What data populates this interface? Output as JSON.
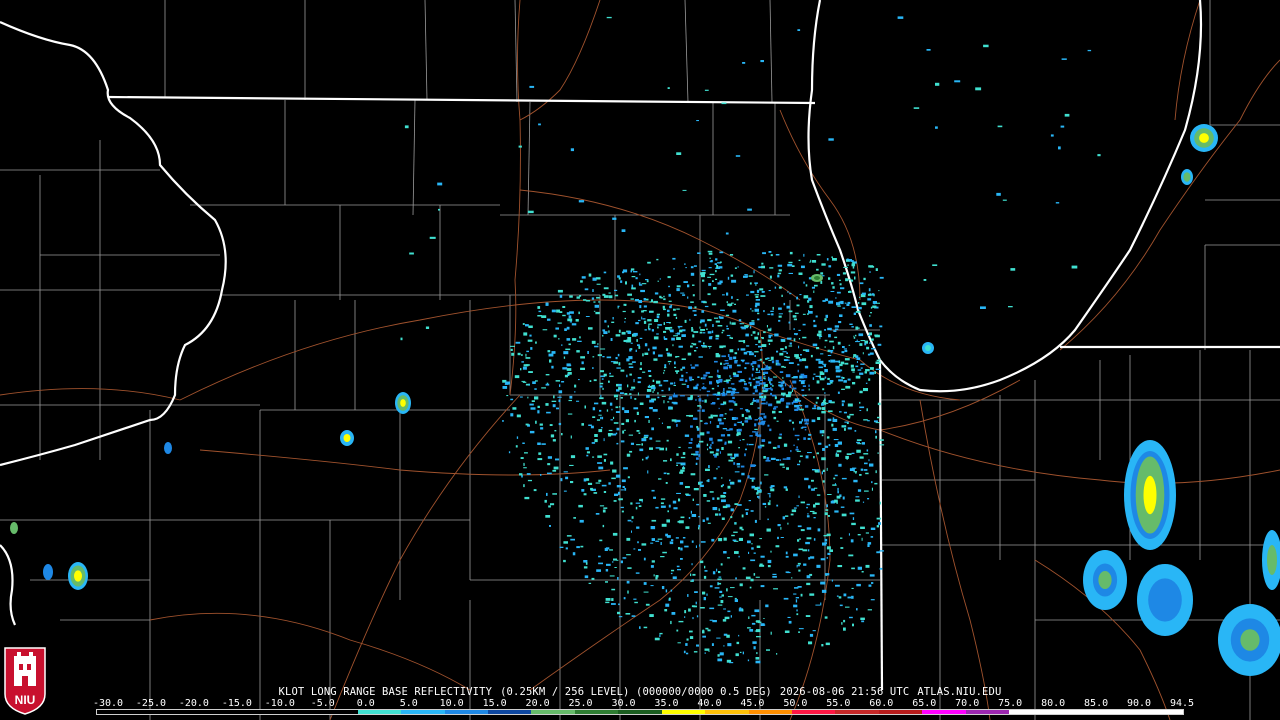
{
  "header": {
    "station": "KLOT LONG RANGE BASE REFLECTIVITY",
    "params": "(0.25KM / 256 LEVEL) (000000/0000 0.5 DEG)",
    "timestamp": "2026-08-06 21:56 UTC",
    "source": "ATLAS.NIU.EDU"
  },
  "logo": {
    "text": "NIU",
    "color": "#c8102e"
  },
  "legend": {
    "ticks": [
      "-30.0",
      "-25.0",
      "-20.0",
      "-15.0",
      "-10.0",
      "-5.0",
      "0.0",
      "5.0",
      "10.0",
      "15.0",
      "20.0",
      "25.0",
      "30.0",
      "35.0",
      "40.0",
      "45.0",
      "50.0",
      "55.0",
      "60.0",
      "65.0",
      "70.0",
      "75.0",
      "80.0",
      "85.0",
      "90.0",
      "94.5"
    ],
    "colors": [
      "#000000",
      "#000000",
      "#000000",
      "#000000",
      "#000000",
      "#000000",
      "#40e0d0",
      "#29b6f6",
      "#1e88e5",
      "#0d47a1",
      "#66bb6a",
      "#2e7d32",
      "#1b5e20",
      "#ffff00",
      "#ffc107",
      "#ff8f00",
      "#ff1744",
      "#c62828",
      "#b71c1c",
      "#ff00ff",
      "#9c27b0",
      "#ffffff",
      "#ffffff",
      "#ffffff",
      "#ffffff"
    ]
  },
  "map_style": {
    "state_border_color": "#ffffff",
    "county_border_color": "#9a9a9a",
    "road_color": "#a0522d",
    "echo_colors": [
      "#40e0d0",
      "#29b6f6",
      "#1e88e5",
      "#2e7d32",
      "#66bb6a",
      "#ffff00",
      "#ffc107"
    ]
  }
}
